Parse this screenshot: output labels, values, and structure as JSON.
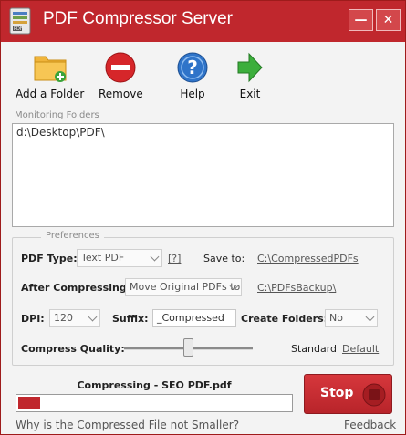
{
  "window": {
    "title": "PDF Compressor Server",
    "minimize_glyph": "—",
    "close_glyph": "✕",
    "accent_color": "#c0272d"
  },
  "toolbar": {
    "items": [
      {
        "label": "Add a Folder",
        "icon": "folder-add-icon"
      },
      {
        "label": "Remove",
        "icon": "remove-icon"
      },
      {
        "label": "Help",
        "icon": "help-icon"
      },
      {
        "label": "Exit",
        "icon": "exit-arrow-icon"
      }
    ]
  },
  "monitoring": {
    "label": "Monitoring Folders",
    "folders": [
      "d:\\Desktop\\PDF\\"
    ]
  },
  "preferences": {
    "legend": "Preferences",
    "pdf_type_label": "PDF Type:",
    "pdf_type_value": "Text PDF",
    "pdf_type_help": "[?]",
    "save_to_label": "Save to:",
    "save_to_path": "C:\\CompressedPDFs",
    "after_compressing_label": "After Compressing:",
    "after_compressing_value": "Move Original PDFs to",
    "backup_path": "C:\\PDFsBackup\\",
    "dpi_label": "DPI:",
    "dpi_value": "120",
    "suffix_label": "Suffix:",
    "suffix_value": "_Compressed",
    "create_folders_label": "Create Folders:",
    "create_folders_value": "No",
    "quality_label": "Compress Quality:",
    "quality_level": 0.5,
    "quality_text": "Standard",
    "default_link": "Default"
  },
  "status": {
    "text": "Compressing - SEO PDF.pdf",
    "progress": 0.08
  },
  "stop_button": {
    "label": "Stop"
  },
  "links": {
    "why_not_smaller": "Why is the Compressed File not Smaller?",
    "feedback": "Feedback"
  }
}
